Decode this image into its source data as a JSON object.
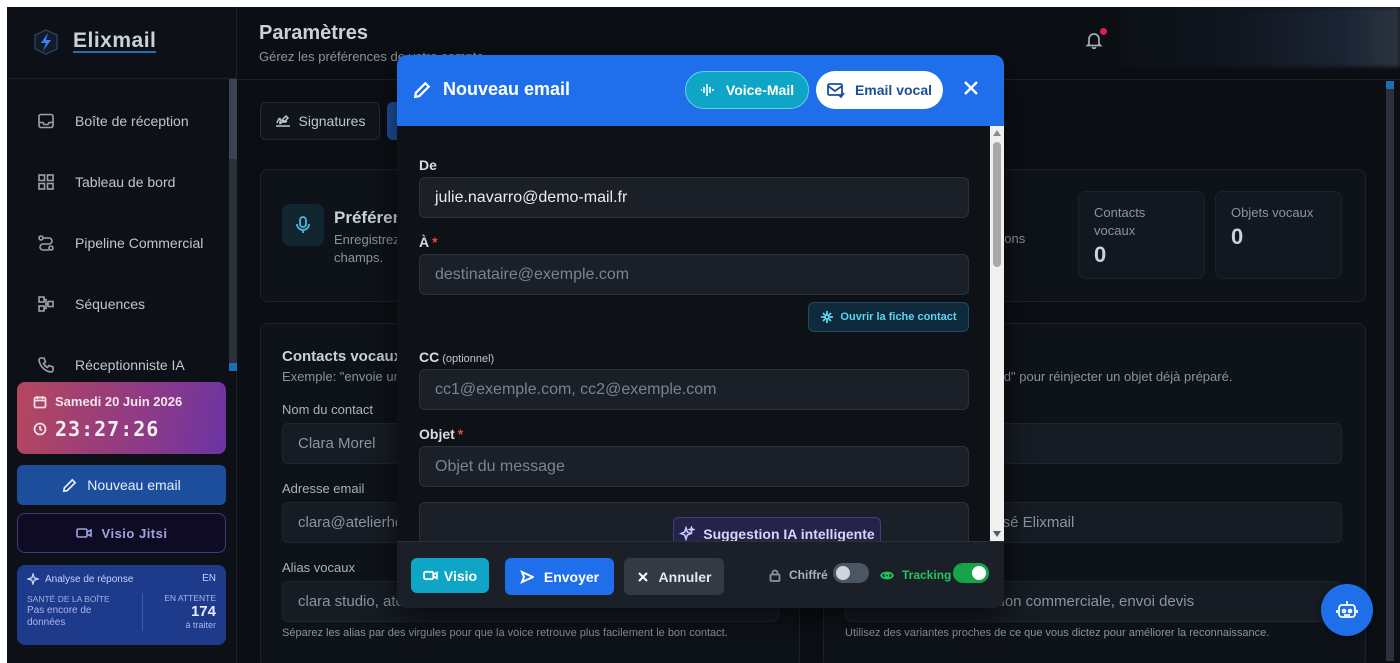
{
  "app": {
    "name": "Elixmail"
  },
  "sidebar": {
    "items": [
      {
        "label": "Boîte de réception",
        "icon": "inbox-icon"
      },
      {
        "label": "Tableau de bord",
        "icon": "dashboard-icon"
      },
      {
        "label": "Pipeline Commercial",
        "icon": "pipeline-icon"
      },
      {
        "label": "Séquences",
        "icon": "sequence-icon"
      },
      {
        "label": "Réceptionniste IA",
        "icon": "phone-icon"
      }
    ],
    "date": "Samedi 20 Juin 2026",
    "time": "23:27:26",
    "new_email_label": "Nouveau email",
    "visio_label": "Visio Jitsi",
    "analysis": {
      "title": "Analyse de réponse",
      "lang": "EN",
      "health_label": "SANTÉ DE LA BOÎTE",
      "health_value": "Pas encore de données",
      "pending_label": "EN ATTENTE",
      "pending_count": "174",
      "pending_sub": "à traiter"
    }
  },
  "header": {
    "title": "Paramètres",
    "subtitle": "Gérez les préférences de votre compte"
  },
  "tabs": {
    "signatures_label": "Signatures"
  },
  "prefs": {
    "title": "Préférences",
    "subtitle": "Enregistrez champs.",
    "right_text": "bons",
    "stats": [
      {
        "label": "Contacts vocaux",
        "value": "0"
      },
      {
        "label": "Objets vocaux",
        "value": "0"
      }
    ]
  },
  "contacts_section": {
    "title": "Contacts vocaux",
    "subtitle": "Exemple: \"envoie un",
    "right_subtitle": "dard\" pour réinjecter un objet déjà préparé.",
    "name_label": "Nom du contact",
    "name_placeholder": "Clara Morel",
    "email_label": "Adresse email",
    "email_placeholder": "clara@atelierhe",
    "alias_label": "Alias vocaux",
    "alias_placeholder": "clara studio, ate",
    "alias_hint": "Séparez les alias par des virgules pour que la voice retrouve plus facilement le bon contact.",
    "right_field2": "lisé Elixmail",
    "right_field3": "ition commerciale, envoi devis",
    "right_hint": "Utilisez des variantes proches de ce que vous dictez pour améliorer la reconnaissance."
  },
  "modal": {
    "title": "Nouveau email",
    "voicemail_label": "Voice-Mail",
    "email_vocal_label": "Email vocal",
    "from_label": "De",
    "from_value": "julie.navarro@demo-mail.fr",
    "to_label": "À",
    "to_placeholder": "destinataire@exemple.com",
    "open_contact_label": "Ouvrir la fiche contact",
    "cc_label": "CC",
    "cc_optional": "(optionnel)",
    "cc_placeholder": "cc1@exemple.com, cc2@exemple.com",
    "subject_label": "Objet",
    "subject_placeholder": "Objet du message",
    "ai_suggest_label": "Suggestion IA intelligente",
    "footer": {
      "visio_label": "Visio",
      "send_label": "Envoyer",
      "cancel_label": "Annuler",
      "encrypted_label": "Chiffré",
      "encrypted_on": false,
      "tracking_label": "Tracking",
      "tracking_on": true
    }
  },
  "colors": {
    "accent": "#1f6feb",
    "cyan": "#0ea5c6",
    "success": "#22c55e",
    "danger": "#ef4444"
  }
}
